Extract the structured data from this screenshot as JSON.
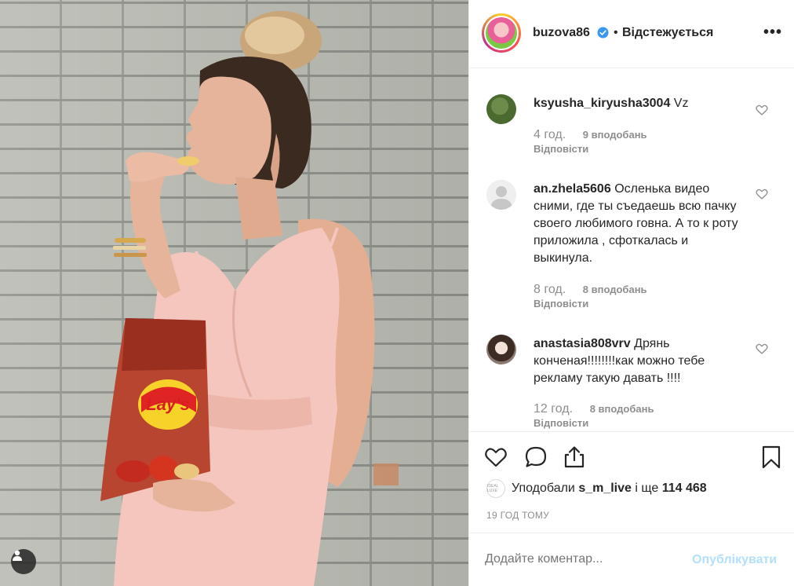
{
  "header": {
    "username": "buzova86",
    "separator": "•",
    "follow_status": "Відстежується",
    "more": "•••"
  },
  "comments": [
    {
      "username": "ksyusha_kiryusha3004",
      "text": "Vz",
      "time": "4 год.",
      "likes": "9 вподобань",
      "reply": "Відповісти"
    },
    {
      "username": "an.zhela5606",
      "text": "Осленька видео сними, где ты съедаешь всю пачку своего любимого говна. А то к роту приложила , сфоткалась и выкинула.",
      "time": "8 год.",
      "likes": "8 вподобань",
      "reply": "Відповісти"
    },
    {
      "username": "anastasia808vrv",
      "text": "Дрянь конченая!!!!!!!!как можно тебе рекламу такую давать !!!!",
      "time": "12 год.",
      "likes": "8 вподобань",
      "reply": "Відповісти"
    }
  ],
  "liked_by": {
    "prefix": "Уподобали",
    "user": "s_m_live",
    "mid": "і ще",
    "count": "114 468",
    "mini_avatar_text": "IDEAL LUXE"
  },
  "timestamp": "19 ГОД ТОМУ",
  "add_comment": {
    "placeholder": "Додайте коментар...",
    "publish_label": "Опублікувати"
  },
  "colors": {
    "dress": "#f4c6bd",
    "wall": "#b9bbb3",
    "chips_bag": "#b8452f",
    "verified_blue": "#3897f0",
    "publish_disabled": "#b2dffc"
  },
  "icons": [
    "user-tag-icon",
    "verified-icon",
    "more-icon",
    "heart-icon",
    "comment-icon",
    "share-icon",
    "bookmark-icon"
  ]
}
